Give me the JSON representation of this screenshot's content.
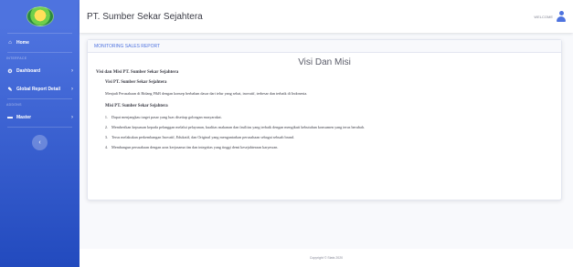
{
  "sidebar": {
    "nav": [
      {
        "label": "Home",
        "icon": "home-icon"
      },
      {
        "label": "Dashboard",
        "icon": "dashboard-icon",
        "chevron": "›"
      },
      {
        "label": "Global Report Detail",
        "icon": "wrench-icon",
        "chevron": "›"
      },
      {
        "label": "Master",
        "icon": "folder-icon",
        "chevron": "›"
      }
    ],
    "headings": [
      "interface",
      "addons"
    ],
    "toggle_glyph": "‹"
  },
  "topbar": {
    "company": "PT. Sumber Sekar Sejahtera",
    "welcome": "WELCOME"
  },
  "card": {
    "header": "MONITORING SALES REPORT",
    "title": "Visi Dan Misi",
    "section_title": "Visi dan Misi PT. Sumber Sekar Sejahtera",
    "visi_title": "Visi PT. Sumber Sekar Sejahtera",
    "visi_text": "Menjadi Perusahaan di Bidang F&B dengan konsep berbahan dasar dari telur yang sehat, inovatif, terbesar dan terbaik di Indonesia.",
    "misi_title": "Misi PT. Sumber Sekar Sejahtera",
    "misi_items": [
      "Dapat menjangkau target pasar yang luas disetiap golongan masyarakat.",
      "Memberikan kepuasan kepada pelanggan melalui pelayanan, kualitas makanan dan fasilitas yang terbaik dengan mengikuti kebutuhan konsumen yang terus berubah.",
      "Terus melakukan perkembangan Inovatif, Edukatif, dan Original yang mengantarkan perusahaan sebagai sebuah brand.",
      "Membangun perusahaan dengan azas kerjasama tim dan integritas yang tinggi demi kesejahteraan karyawan."
    ]
  },
  "footer": {
    "text": "Copyright © Stats 2020"
  },
  "colors": {
    "sidebar_start": "#4e73df",
    "sidebar_end": "#224abe",
    "accent": "#4e73df",
    "background": "#f8f9fc"
  }
}
